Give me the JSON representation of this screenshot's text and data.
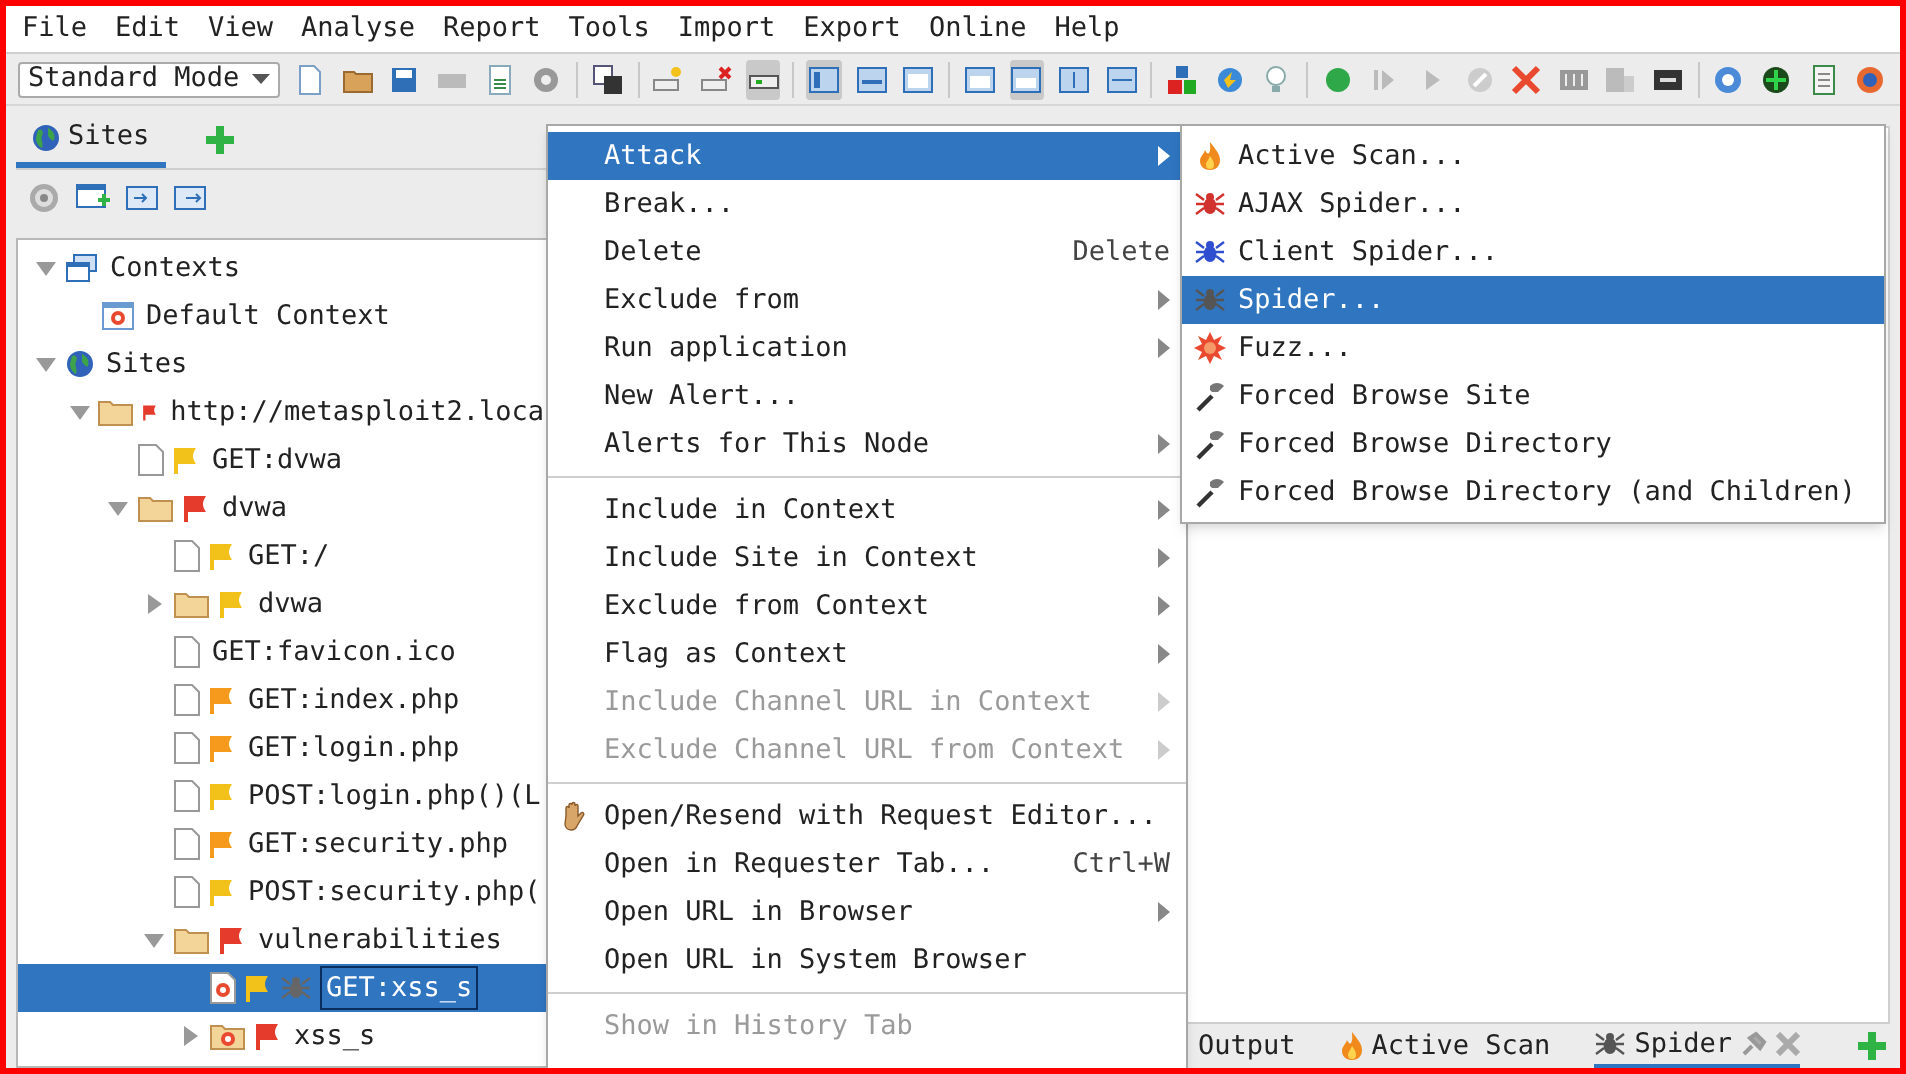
{
  "menu_bar": [
    "File",
    "Edit",
    "View",
    "Analyse",
    "Report",
    "Tools",
    "Import",
    "Export",
    "Online",
    "Help"
  ],
  "toolbar": {
    "mode": "Standard Mode",
    "buttons": [
      {
        "pressed": false
      },
      {
        "pressed": false
      },
      {
        "pressed": false
      },
      {
        "pressed": false
      },
      {
        "pressed": false
      },
      {
        "pressed": false
      },
      {
        "pressed": false
      },
      {
        "pressed": false
      },
      {
        "pressed": false
      },
      {
        "pressed": true
      },
      {
        "pressed": true
      },
      {
        "pressed": false
      },
      {
        "pressed": false
      },
      {
        "pressed": false
      },
      {
        "pressed": true
      },
      {
        "pressed": false
      },
      {
        "pressed": false
      },
      {
        "pressed": false
      },
      {
        "pressed": false
      },
      {
        "pressed": false
      },
      {
        "pressed": false
      },
      {
        "pressed": false
      },
      {
        "pressed": false
      },
      {
        "pressed": false
      },
      {
        "pressed": false
      },
      {
        "pressed": false
      },
      {
        "pressed": false
      },
      {
        "pressed": false
      },
      {
        "pressed": false
      },
      {
        "pressed": false
      },
      {
        "pressed": false
      },
      {
        "pressed": false
      }
    ]
  },
  "sites_panel": {
    "tabs": [
      {
        "label": "Sites",
        "selected": true
      }
    ],
    "tree": [
      {
        "label": "Contexts",
        "kind": "contexts",
        "expanded": true,
        "selected": false,
        "spidered": false,
        "children": [
          {
            "label": "Default Context",
            "kind": "context",
            "selected": false,
            "spidered": false
          }
        ]
      },
      {
        "label": "Sites",
        "kind": "sites",
        "expanded": true,
        "selected": false,
        "spidered": false,
        "children": [
          {
            "label": "http://metasploit2.loca",
            "kind": "folder",
            "color": "#e53b2c",
            "expanded": true,
            "selected": false,
            "in_context": false,
            "spidered": false,
            "children": [
              {
                "label": "GET:dvwa",
                "kind": "page",
                "color": "#f2c21b",
                "selected": false,
                "in_context": false,
                "spidered": false
              },
              {
                "label": "dvwa",
                "kind": "folder",
                "color": "#e53b2c",
                "expanded": true,
                "selected": false,
                "in_context": false,
                "spidered": false,
                "children": [
                  {
                    "label": "GET:/",
                    "kind": "page",
                    "color": "#f2c21b",
                    "selected": false,
                    "in_context": false,
                    "spidered": false
                  },
                  {
                    "label": "dvwa",
                    "kind": "folder",
                    "color": "#f2c21b",
                    "expanded": false,
                    "selected": false,
                    "in_context": false,
                    "spidered": false
                  },
                  {
                    "label": "GET:favicon.ico",
                    "kind": "page",
                    "selected": false,
                    "in_context": false,
                    "spidered": false
                  },
                  {
                    "label": "GET:index.php",
                    "kind": "page",
                    "color": "#f59a1c",
                    "selected": false,
                    "in_context": false,
                    "spidered": false
                  },
                  {
                    "label": "GET:login.php",
                    "kind": "page",
                    "color": "#f59a1c",
                    "selected": false,
                    "in_context": false,
                    "spidered": false
                  },
                  {
                    "label": "POST:login.php()(L",
                    "kind": "page",
                    "color": "#f2c21b",
                    "selected": false,
                    "in_context": false,
                    "spidered": false
                  },
                  {
                    "label": "GET:security.php",
                    "kind": "page",
                    "color": "#f59a1c",
                    "selected": false,
                    "in_context": false,
                    "spidered": false
                  },
                  {
                    "label": "POST:security.php(",
                    "kind": "page",
                    "color": "#f2c21b",
                    "selected": false,
                    "in_context": false,
                    "spidered": false
                  },
                  {
                    "label": "vulnerabilities",
                    "kind": "folder",
                    "color": "#e53b2c",
                    "expanded": true,
                    "selected": false,
                    "in_context": false,
                    "spidered": false,
                    "children": [
                      {
                        "label": "GET:xss_s",
                        "kind": "page",
                        "color": "#f2c21b",
                        "selected": true,
                        "in_context": true,
                        "spidered": true
                      },
                      {
                        "label": "xss_s",
                        "kind": "folder",
                        "color": "#e53b2c",
                        "expanded": false,
                        "selected": false,
                        "in_context": true,
                        "spidered": false
                      }
                    ]
                  }
                ]
              }
            ]
          }
        ]
      }
    ]
  },
  "context_menu": [
    {
      "kind": "item",
      "label": "Attack",
      "submenu": true,
      "selected": true,
      "disabled": false
    },
    {
      "kind": "item",
      "label": "Break...",
      "submenu": false,
      "selected": false,
      "disabled": false
    },
    {
      "kind": "item",
      "label": "Delete",
      "shortcut": "Delete",
      "submenu": false,
      "selected": false,
      "disabled": false
    },
    {
      "kind": "item",
      "label": "Exclude from",
      "submenu": true,
      "selected": false,
      "disabled": false
    },
    {
      "kind": "item",
      "label": "Run application",
      "submenu": true,
      "selected": false,
      "disabled": false
    },
    {
      "kind": "item",
      "label": "New Alert...",
      "submenu": false,
      "selected": false,
      "disabled": false
    },
    {
      "kind": "item",
      "label": "Alerts for This Node",
      "submenu": true,
      "selected": false,
      "disabled": false
    },
    {
      "kind": "separator"
    },
    {
      "kind": "item",
      "label": "Include in Context",
      "submenu": true,
      "selected": false,
      "disabled": false
    },
    {
      "kind": "item",
      "label": "Include Site in Context",
      "submenu": true,
      "selected": false,
      "disabled": false
    },
    {
      "kind": "item",
      "label": "Exclude from Context",
      "submenu": true,
      "selected": false,
      "disabled": false
    },
    {
      "kind": "item",
      "label": "Flag as Context",
      "submenu": true,
      "selected": false,
      "disabled": false
    },
    {
      "kind": "item",
      "label": "Include Channel URL in Context",
      "submenu": true,
      "selected": false,
      "disabled": true
    },
    {
      "kind": "item",
      "label": "Exclude Channel URL from Context",
      "submenu": true,
      "selected": false,
      "disabled": true
    },
    {
      "kind": "separator"
    },
    {
      "kind": "item",
      "label": "Open/Resend with Request Editor...",
      "submenu": false,
      "selected": false,
      "disabled": false,
      "icon": true
    },
    {
      "kind": "item",
      "label": "Open in Requester Tab...",
      "shortcut": "Ctrl+W",
      "submenu": false,
      "selected": false,
      "disabled": false
    },
    {
      "kind": "item",
      "label": "Open URL in Browser",
      "submenu": true,
      "selected": false,
      "disabled": false
    },
    {
      "kind": "item",
      "label": "Open URL in System Browser",
      "submenu": false,
      "selected": false,
      "disabled": false
    },
    {
      "kind": "separator"
    },
    {
      "kind": "item",
      "label": "Show in History Tab",
      "submenu": false,
      "selected": false,
      "disabled": true
    }
  ],
  "attack_submenu": [
    {
      "label": "Active Scan...",
      "kind": "flame",
      "selected": false
    },
    {
      "label": "AJAX Spider...",
      "kind": "red-spider",
      "selected": false
    },
    {
      "label": "Client Spider...",
      "kind": "blue-spider",
      "selected": false
    },
    {
      "label": "Spider...",
      "kind": "spider",
      "selected": true
    },
    {
      "label": "Fuzz...",
      "kind": "burst",
      "selected": false
    },
    {
      "label": "Forced Browse Site",
      "kind": "tool",
      "selected": false
    },
    {
      "label": "Forced Browse Directory",
      "kind": "tool",
      "selected": false
    },
    {
      "label": "Forced Browse Directory (and Children)",
      "kind": "tool",
      "selected": false
    }
  ],
  "bottom_tabs": [
    {
      "label": "Output",
      "kind": "plain",
      "selected": false
    },
    {
      "label": "Active Scan",
      "kind": "flame",
      "selected": false
    },
    {
      "label": "Spider",
      "kind": "spider",
      "selected": true
    }
  ]
}
